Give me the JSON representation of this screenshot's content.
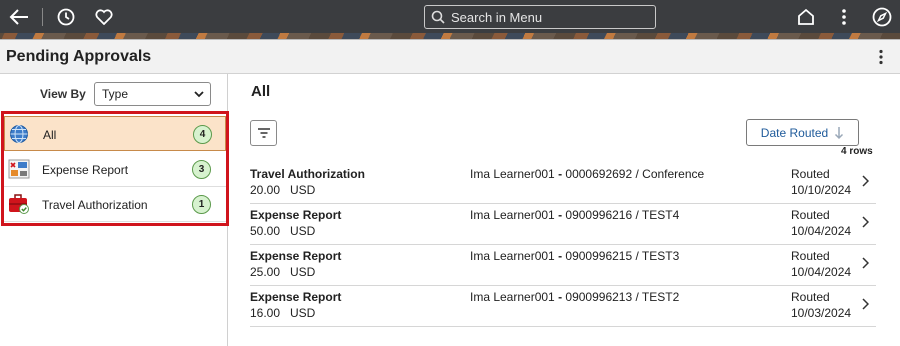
{
  "header": {
    "search_placeholder": "Search in Menu"
  },
  "page": {
    "title": "Pending Approvals"
  },
  "view_by": {
    "label": "View By",
    "selected": "Type"
  },
  "nav": {
    "items": [
      {
        "label": "All",
        "count": "4",
        "icon": "globe-icon",
        "selected": true
      },
      {
        "label": "Expense Report",
        "count": "3",
        "icon": "expense-report-icon",
        "selected": false
      },
      {
        "label": "Travel Authorization",
        "count": "1",
        "icon": "travel-authorization-icon",
        "selected": false
      }
    ]
  },
  "main": {
    "title": "All",
    "sort_label": "Date Routed",
    "row_count": "4 rows",
    "rows": [
      {
        "type": "Travel Authorization",
        "amount": "20.00",
        "currency": "USD",
        "person": "Ima Learner001",
        "sep": " - ",
        "ref": "0000692692 / Conference",
        "status": "Routed",
        "date": "10/10/2024"
      },
      {
        "type": "Expense Report",
        "amount": "50.00",
        "currency": "USD",
        "person": "Ima Learner001",
        "sep": " - ",
        "ref": "0900996216 / TEST4",
        "status": "Routed",
        "date": "10/04/2024"
      },
      {
        "type": "Expense Report",
        "amount": "25.00",
        "currency": "USD",
        "person": "Ima Learner001",
        "sep": " - ",
        "ref": "0900996215 / TEST3",
        "status": "Routed",
        "date": "10/04/2024"
      },
      {
        "type": "Expense Report",
        "amount": "16.00",
        "currency": "USD",
        "person": "Ima Learner001",
        "sep": " - ",
        "ref": "0900996213 / TEST2",
        "status": "Routed",
        "date": "10/03/2024"
      }
    ]
  },
  "colors": {
    "selected_bg": "#fbe3c9",
    "badge_bg": "#d7f2cf",
    "highlight_border": "#d0141c",
    "link_blue": "#1e5a9a"
  }
}
